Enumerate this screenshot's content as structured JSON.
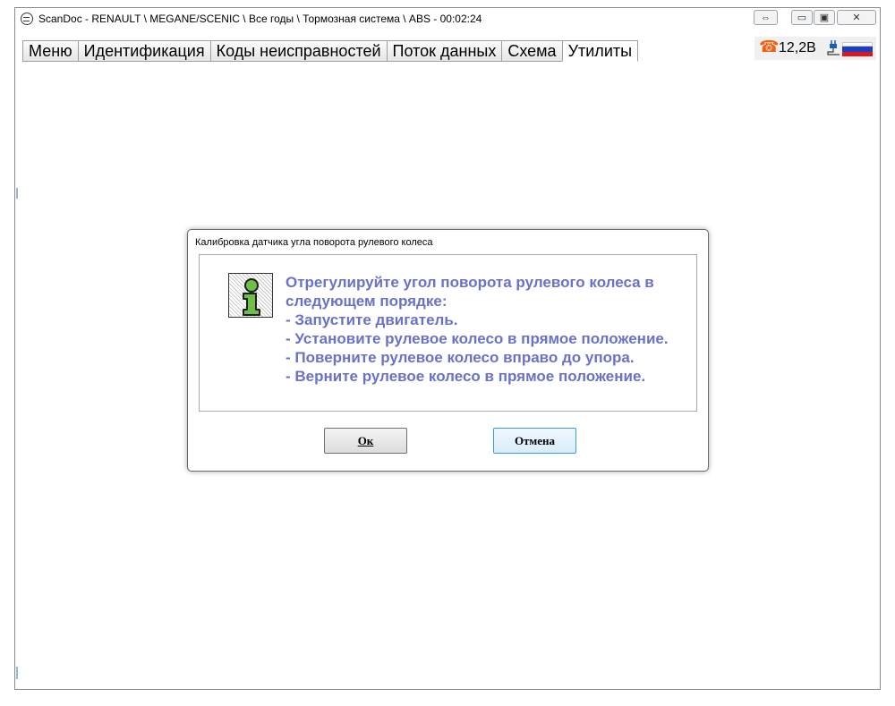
{
  "window": {
    "title": "ScanDoc - RENAULT \\ MEGANE/SCENIC \\ Все годы \\ Тормозная система \\ ABS - 00:02:24"
  },
  "window_controls": {
    "resize_glyph": "⇔",
    "minimize_glyph": "▭",
    "maximize_glyph": "▣",
    "close_glyph": "✕"
  },
  "tabs": [
    {
      "label": "Меню"
    },
    {
      "label": "Идентификация"
    },
    {
      "label": "Коды неисправностей"
    },
    {
      "label": "Поток данных"
    },
    {
      "label": "Схема"
    },
    {
      "label": "Утилиты",
      "active": true
    }
  ],
  "status": {
    "voltage": "12,2В",
    "phone_icon": "phone-icon",
    "plug_icon": "plug-icon",
    "flag_icon": "russian-flag-icon",
    "accent_color": "#f06010"
  },
  "dialog": {
    "title": "Калибровка датчика угла поворота рулевого колеса",
    "icon": "info-icon",
    "message": "Отрегулируйте угол поворота рулевого колеса в следующем порядке:\n  - Запустите двигатель.\n  - Установите рулевое колесо в прямое положение.\n  - Поверните рулевое колесо вправо до упора.\n  - Верните рулевое колесо в прямое положение.",
    "message_color": "#6a72c8",
    "ok_label": "Ок",
    "cancel_label": "Отмена"
  }
}
